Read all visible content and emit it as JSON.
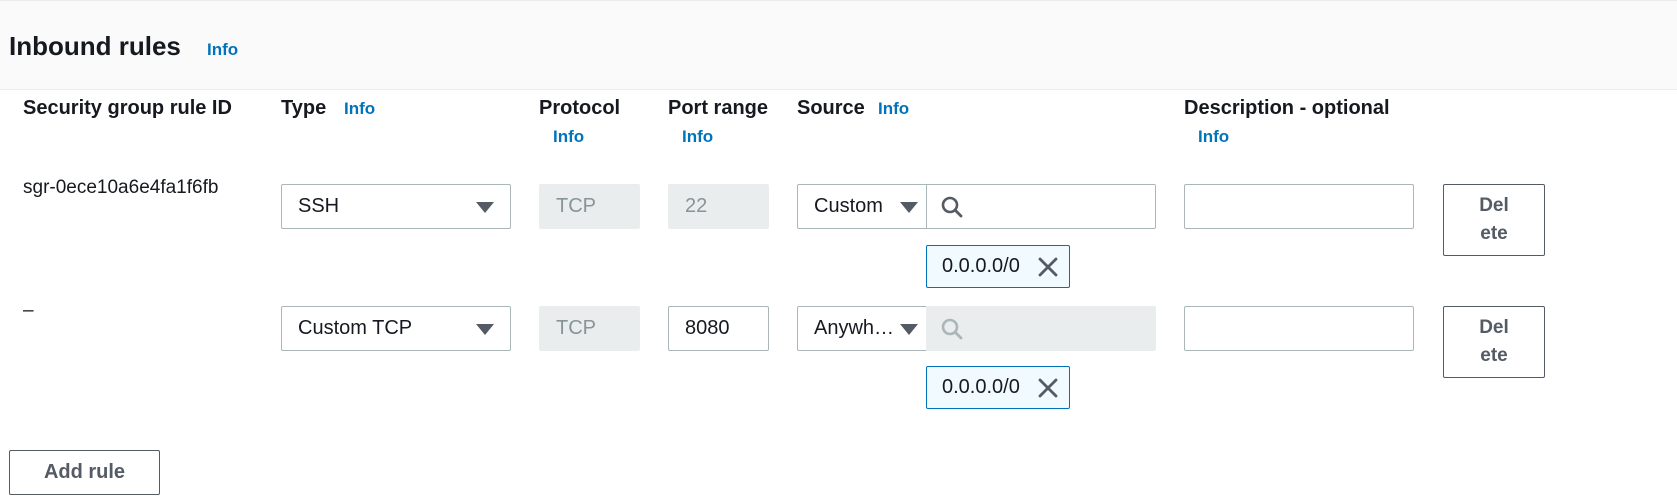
{
  "panel": {
    "title": "Inbound rules",
    "info": "Info"
  },
  "columns": {
    "rule_id": "Security group rule ID",
    "type": "Type",
    "type_info": "Info",
    "protocol": "Protocol",
    "protocol_info": "Info",
    "port_range": "Port range",
    "port_range_info": "Info",
    "source": "Source",
    "source_info": "Info",
    "description": "Description - optional",
    "description_info": "Info"
  },
  "rules": [
    {
      "rule_id": "sgr-0ece10a6e4fa1f6fb",
      "type": "SSH",
      "protocol": "TCP",
      "port_range": "22",
      "source_mode": "Custom",
      "source_search": "",
      "source_token": "0.0.0.0/0",
      "description": "",
      "delete_label": "Delete"
    },
    {
      "rule_id": "–",
      "type": "Custom TCP",
      "protocol": "TCP",
      "port_range": "8080",
      "source_mode": "Anywh…",
      "source_search": "",
      "source_token": "0.0.0.0/0",
      "description": "",
      "delete_label": "Delete"
    }
  ],
  "add_rule_label": "Add rule",
  "icons": {
    "dropdown": "caret-down-icon",
    "search": "search-icon",
    "remove": "close-icon"
  },
  "colors": {
    "link": "#0073bb",
    "token_border": "#0073bb",
    "token_bg": "#f1faff",
    "disabled_bg": "#eaeded"
  }
}
